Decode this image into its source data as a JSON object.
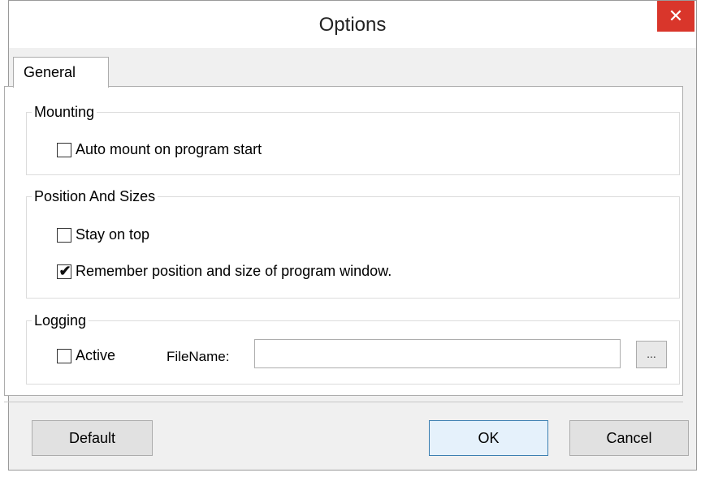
{
  "window": {
    "title": "Options",
    "close_symbol": "✕"
  },
  "tabs": [
    {
      "label": "General",
      "active": true
    }
  ],
  "groups": {
    "mounting": {
      "title": "Mounting",
      "auto_mount": {
        "label": "Auto mount on program start",
        "checked": false
      }
    },
    "position": {
      "title": "Position And Sizes",
      "stay_on_top": {
        "label": "Stay on top",
        "checked": false
      },
      "remember": {
        "label": "Remember position and size of program window.",
        "checked": true
      }
    },
    "logging": {
      "title": "Logging",
      "active": {
        "label": "Active",
        "checked": false
      },
      "filename_label": "FileName:",
      "filename_value": "",
      "browse_label": "..."
    }
  },
  "buttons": {
    "default": "Default",
    "ok": "OK",
    "cancel": "Cancel"
  },
  "checkmark": "✔",
  "colors": {
    "close_bg": "#d9362b",
    "ok_border": "#3c7fb1",
    "ok_bg": "#e5f1fb"
  }
}
